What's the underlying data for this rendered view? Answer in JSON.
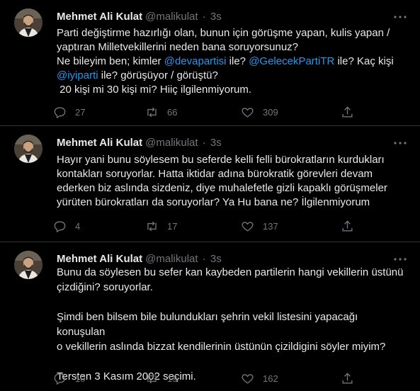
{
  "tweets": [
    {
      "author": "Mehmet Ali Kulat",
      "handle": "@malikulat",
      "dot": "·",
      "time": "3s",
      "lines": [
        "Parti değiştirme hazırlığı olan, bunun için görüşme yapan, kulis yapan /",
        "yaptıran Milletvekillerini neden bana soruyorsunuz?"
      ],
      "mention_line_1": {
        "pre": "Ne bileyim ben; kimler ",
        "m1": "@devapartisi",
        "mid": " ile? ",
        "m2": "@GelecekPartiTR",
        "post": " ile? Kaç kişi"
      },
      "mention_line_2": {
        "m1": "@iyiparti",
        "post": " ile? görüşüyor / görüştü?"
      },
      "last_line": " 20 kişi mi 30 kişi mi? Hiiç ilgilenmiyorum.",
      "replies": "27",
      "retweets": "66",
      "likes": "309"
    },
    {
      "author": "Mehmet Ali Kulat",
      "handle": "@malikulat",
      "dot": "·",
      "time": "3s",
      "lines": [
        "Hayır yani bunu söylesem bu seferde kelli felli bürokratların kurdukları",
        "kontakları soruyorlar. Hatta iktidar adına bürokratik görevleri devam",
        "ederken biz aslında sizdeniz, diye muhalefetle gizli kapaklı görüşmeler",
        "yürüten bürokratları da soruyorlar? Ya Hu bana ne? İlgilenmiyorum"
      ],
      "replies": "4",
      "retweets": "17",
      "likes": "137"
    },
    {
      "author": "Mehmet Ali Kulat",
      "handle": "@malikulat",
      "dot": "·",
      "time": "3s",
      "lines": [
        "Bunu da söylesen bu sefer kan kaybeden partilerin hangi vekillerin üstünü",
        "çizdiğini? soruyorlar.",
        "",
        "Şimdi ben bilsem bile bulundukları şehrin vekil listesini yapacağı konuşulan",
        "o vekillerin aslında bizzat kendilerinin üstünün çizildigini söyler miyim?",
        "",
        "Tersten 3 Kasım 2002 seçimi."
      ],
      "replies": "10",
      "retweets": "19",
      "likes": "162"
    }
  ]
}
